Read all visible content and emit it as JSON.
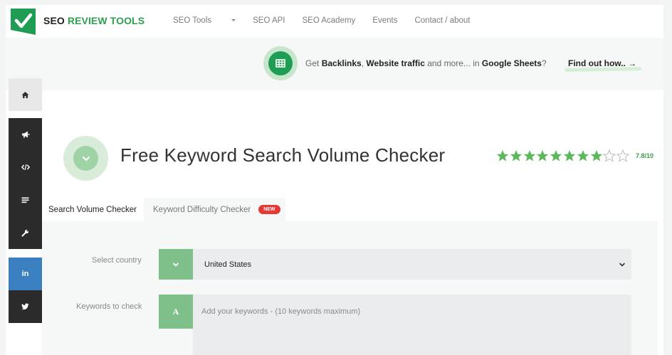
{
  "brand": {
    "name_part1": "SEO ",
    "name_part2": "REVIEW TOOLS",
    "accent": "#2e9e4f"
  },
  "nav": {
    "items": [
      "SEO Tools",
      "SEO API",
      "SEO Academy",
      "Events",
      "Contact / about"
    ]
  },
  "promo": {
    "icon": "spreadsheet-icon",
    "text_pre": "Get ",
    "bold1": "Backlinks",
    "sep1": ", ",
    "bold2": "Website traffic",
    "mid": " and more... in ",
    "bold3": "Google Sheets",
    "end": "?",
    "cta": "Find out how.. →"
  },
  "sidebar": {
    "items": [
      {
        "icon": "home-icon"
      },
      {
        "icon": "megaphone-icon"
      },
      {
        "icon": "code-icon"
      },
      {
        "icon": "list-icon"
      },
      {
        "icon": "wrench-icon"
      },
      {
        "icon": "linkedin-icon"
      },
      {
        "icon": "twitter-icon"
      }
    ]
  },
  "hero": {
    "title": "Free Keyword Search Volume Checker",
    "icon": "chevron-down-icon"
  },
  "rating": {
    "value_text": "7.8/10",
    "stars_filled": 8,
    "stars_total": 10,
    "color": "#5cb85c"
  },
  "tabs": [
    {
      "label": "Search Volume Checker",
      "active": true
    },
    {
      "label": "Keyword Difficulty Checker",
      "active": false,
      "badge": "NEW"
    }
  ],
  "form": {
    "country_label": "Select country",
    "country_value": "United States",
    "keywords_label": "Keywords to check",
    "keywords_placeholder": "Add your keywords - (10 keywords maximum)",
    "keywords_addon": "A"
  }
}
